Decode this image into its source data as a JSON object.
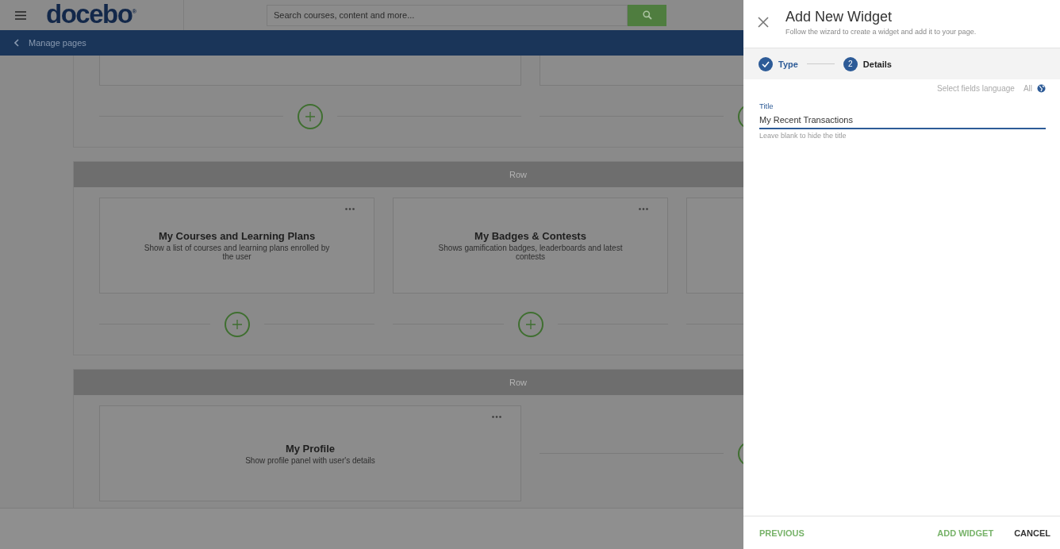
{
  "top_bar": {
    "logo": "docebo",
    "logo_mark": "®",
    "search": {
      "placeholder": "Search courses, content and more..."
    }
  },
  "breadcrumb": {
    "label": "Manage pages"
  },
  "sections": [
    {
      "widgets": [
        {
          "kind": "empty"
        },
        {
          "kind": "empty"
        }
      ]
    },
    {
      "label": "Row",
      "widgets": [
        {
          "kind": "widget",
          "title": "My Courses and Learning Plans",
          "description": "Show a list of courses and learning plans enrolled by the user"
        },
        {
          "kind": "widget",
          "title": "My Badges & Contests",
          "description": "Shows gamification badges, leaderboards and latest contests"
        },
        {
          "kind": "empty"
        }
      ]
    },
    {
      "label": "Row",
      "widgets": [
        {
          "kind": "widget",
          "title": "My Profile",
          "description": "Show profile panel with user's details"
        },
        {
          "kind": "slot"
        }
      ]
    }
  ],
  "panel": {
    "title": "Add New Widget",
    "subtitle": "Follow the wizard to create a widget and add it to your page.",
    "steps": [
      {
        "label": "Type",
        "done": true,
        "selected": false
      },
      {
        "label": "Details",
        "number": "2",
        "done": false,
        "selected": true
      }
    ],
    "language": {
      "label": "Select fields language",
      "value": "All"
    },
    "field": {
      "label": "Title",
      "value": "My Recent Transactions",
      "hint": "Leave blank to hide the title",
      "focused": true
    },
    "buttons": [
      {
        "label": "PREVIOUS",
        "kind": "secondary"
      },
      {
        "label": "ADD WIDGET",
        "kind": "primary"
      },
      {
        "label": "CANCEL",
        "kind": "plain"
      }
    ]
  }
}
